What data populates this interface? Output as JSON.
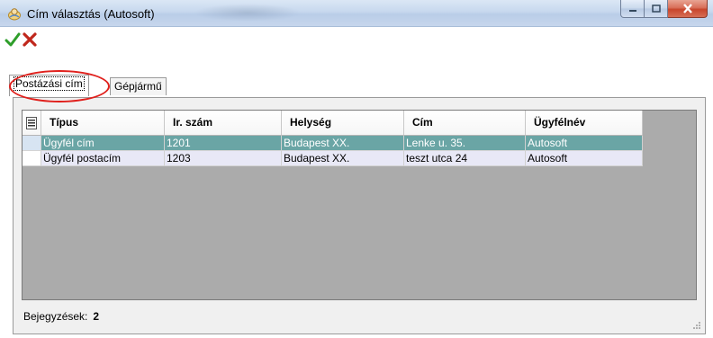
{
  "window": {
    "title": "Cím választás (Autosoft)",
    "icon": "address-book-icon"
  },
  "toolbar": {
    "ok_icon": "checkmark-icon",
    "cancel_icon": "red-x-icon"
  },
  "tabs": [
    {
      "label": "Postázási cím",
      "active": true
    },
    {
      "label": "Gépjármű",
      "active": false
    }
  ],
  "grid": {
    "columns": [
      "Típus",
      "Ir. szám",
      "Helység",
      "Cím",
      "Ügyfélnév"
    ],
    "rows": [
      {
        "tipus": "Ügyfél cím",
        "irszam": "1201",
        "helyseg": "Budapest XX.",
        "cim": "Lenke u. 35.",
        "ugyfelnev": "Autosoft",
        "selected": true
      },
      {
        "tipus": "Ügyfél postacím",
        "irszam": "1203",
        "helyseg": "Budapest XX.",
        "cim": "teszt utca 24",
        "ugyfelnev": "Autosoft",
        "selected": false
      }
    ]
  },
  "status": {
    "label": "Bejegyzések:",
    "count": "2"
  },
  "colors": {
    "selected_row": "#6aa5a5",
    "alt_row": "#e8e8f6",
    "highlight": "#e0201c"
  }
}
